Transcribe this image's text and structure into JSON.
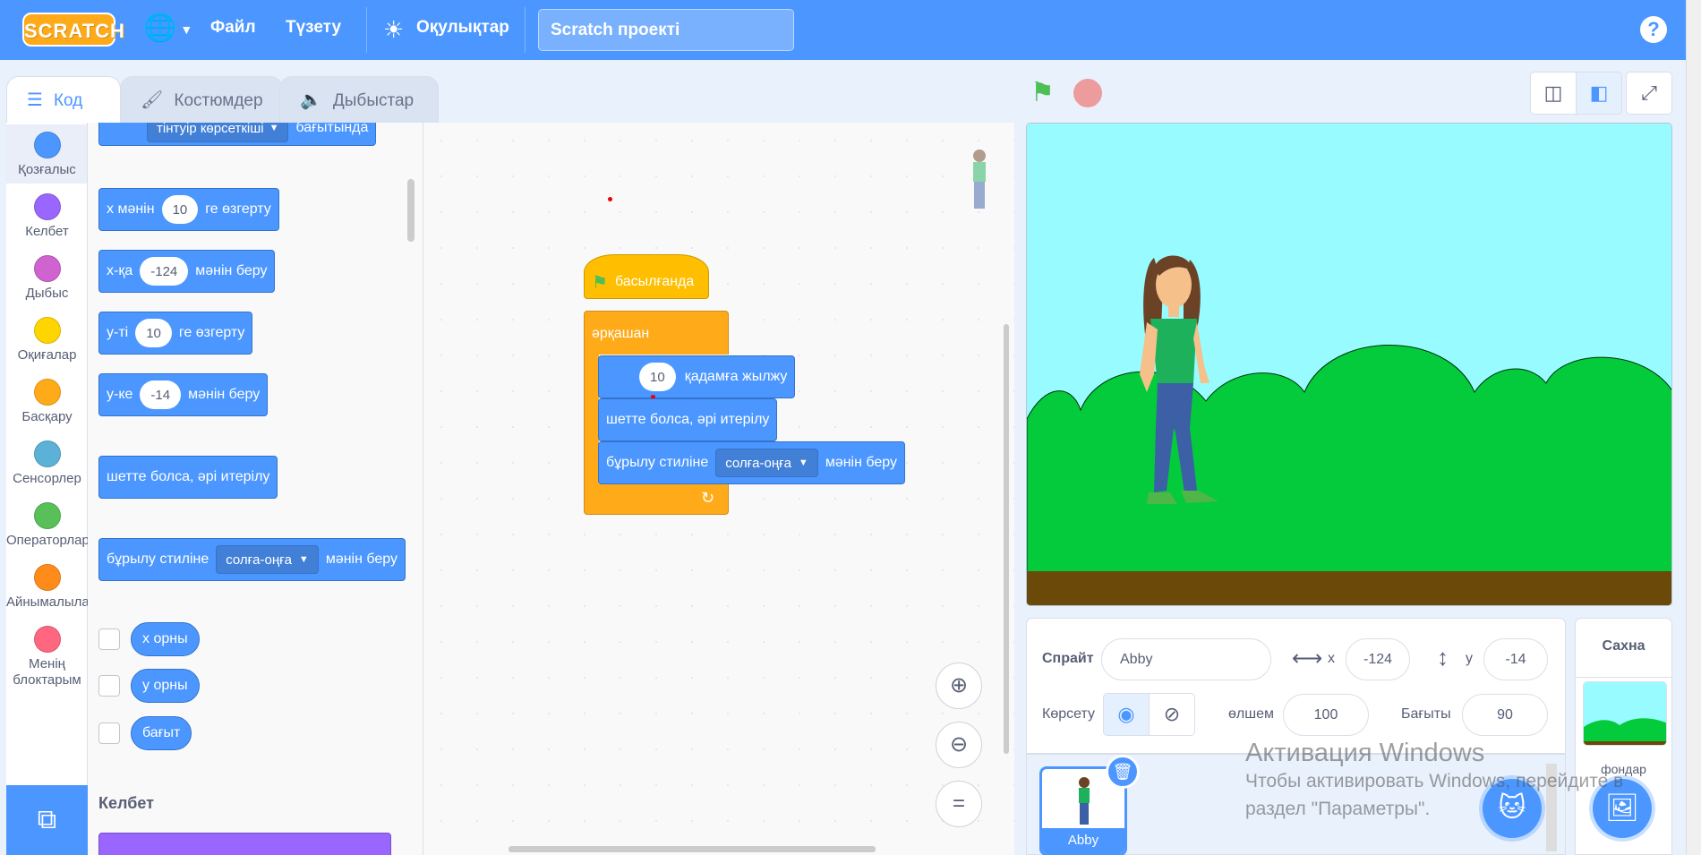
{
  "menubar": {
    "logo": "SCRATCH",
    "file": "Файл",
    "edit": "Түзету",
    "tutorials": "Оқулықтар",
    "project_title": "Scratch  проекті",
    "help": "?"
  },
  "tabs": {
    "code": "Код",
    "costumes": "Костюмдер",
    "sounds": "Дыбыстар"
  },
  "categories": [
    {
      "label": "Қозғалыс",
      "color": "#4c97ff"
    },
    {
      "label": "Келбет",
      "color": "#9966ff"
    },
    {
      "label": "Дыбыс",
      "color": "#cf63cf"
    },
    {
      "label": "Оқиғалар",
      "color": "#ffd500"
    },
    {
      "label": "Басқару",
      "color": "#ffab19"
    },
    {
      "label": "Сенсорлер",
      "color": "#5cb1d6"
    },
    {
      "label": "Операторлар",
      "color": "#59c059"
    },
    {
      "label": "Айнымалылар",
      "color": "#ff8c1a"
    },
    {
      "label": "Менің блоктарым",
      "color": "#ff6680"
    }
  ],
  "palette": {
    "point_towards": {
      "dropdown": "тінтуір көрсеткіші",
      "suffix": "бағытында"
    },
    "change_x": {
      "prefix": "x мәнін",
      "value": "10",
      "suffix": "ге өзгерту"
    },
    "set_x": {
      "prefix": "x-қа",
      "value": "-124",
      "suffix": "мәнін беру"
    },
    "change_y": {
      "prefix": "y-ті",
      "value": "10",
      "suffix": "ге өзгерту"
    },
    "set_y": {
      "prefix": "y-ке",
      "value": "-14",
      "suffix": "мәнін беру"
    },
    "bounce": "шетте болса, әрі итерілу",
    "rotation_style": {
      "prefix": "бұрылу стиліне",
      "dropdown": "солға-оңға",
      "suffix": "мәнін беру"
    },
    "x_position": "x орны",
    "y_position": "y орны",
    "direction": "бағыт",
    "looks_heading": "Келбет"
  },
  "script": {
    "hat": "басылғанда",
    "forever": "әрқашан",
    "move": {
      "value": "10",
      "suffix": "қадамға жылжу"
    },
    "bounce": "шетте болса, әрі итерілу",
    "rotation_style": {
      "prefix": "бұрылу стиліне",
      "dropdown": "солға-оңға",
      "suffix": "мәнін беру"
    }
  },
  "sprite_info": {
    "sprite_label": "Спрайт",
    "sprite_name": "Abby",
    "x_label": "x",
    "x_value": "-124",
    "y_label": "y",
    "y_value": "-14",
    "show_label": "Көрсету",
    "size_label": "өлшем",
    "size_value": "100",
    "direction_label": "Бағыты",
    "direction_value": "90"
  },
  "sprites": [
    {
      "name": "Abby"
    }
  ],
  "stage_panel": {
    "title": "Сахна",
    "backdrop_label": "фондар"
  },
  "windows_activation": {
    "title": "Активация Windows",
    "line1": "Чтобы активировать Windows, перейдите в",
    "line2": "раздел \"Параметры\"."
  }
}
